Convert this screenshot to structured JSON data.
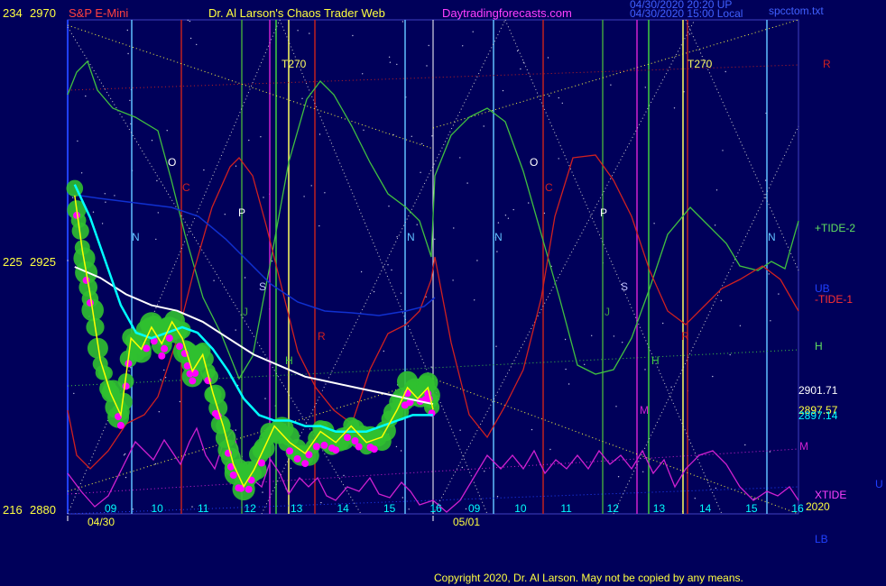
{
  "header": {
    "left_scale": "234",
    "left_price": "2970",
    "symbol": "S&P E-Mini",
    "title": "Dr. Al Larson's Chaos Trader Web",
    "site": "Daytradingforecasts.com",
    "stamp1": "04/30/2020 20:20 UP",
    "stamp2": "04/30/2020 15:00 Local",
    "file": "spcctom.txt"
  },
  "left_axis": {
    "mid_scale": "225",
    "mid_price": "2925",
    "low_scale": "216",
    "low_price": "2880"
  },
  "dates": [
    "04/30",
    "05/01"
  ],
  "hours_day1": [
    "09",
    "10",
    "11",
    "12",
    "13",
    "14",
    "15",
    "16"
  ],
  "hours_day2": [
    "09",
    "10",
    "11",
    "12",
    "13",
    "14",
    "15",
    "16"
  ],
  "year_label": "2020",
  "right_labels": {
    "r": "R",
    "tide2": "+TIDE-2",
    "ub": "UB",
    "tide1": "-TIDE-1",
    "h": "H",
    "m": "M",
    "xtide": "XTIDE",
    "lb": "LB",
    "u": "U",
    "price1": "2901.71",
    "price2": "2897.57",
    "price3": "2897.14"
  },
  "chart_labels": {
    "t270": "T270",
    "o": "O",
    "c": "C",
    "p": "P",
    "n": "N",
    "s": "S",
    "j": "J",
    "h": "H",
    "r": "R",
    "m": "M"
  },
  "copyright": "Copyright 2020, Dr. Al Larson. May not be copied by any means.",
  "colors": {
    "background": "#00005a",
    "frame": "#4040c0",
    "price": "#ffff00",
    "avg_fast": "#00ffff",
    "avg_slow": "#ffffff",
    "tide2": "#40c040",
    "tide1": "#d02020",
    "ub": "#1030d0",
    "xtide": "#d020d0",
    "cluster": "#30c030",
    "dots": "#ff00ff",
    "label_yellow": "#ffff40"
  },
  "chart_data": {
    "type": "line",
    "title": "S&P E-Mini",
    "ylim": [
      2880,
      2970
    ],
    "x_unit": "hour of session",
    "series": [
      {
        "name": "",
        "color": "yellow",
        "x": [
          9.0,
          9.15,
          9.3,
          9.5,
          9.7,
          9.9,
          10.1,
          10.3,
          10.5,
          10.7,
          10.9,
          11.1,
          11.3,
          11.5,
          11.7,
          11.9,
          12.1,
          12.3,
          12.5,
          12.7,
          12.9,
          13.2,
          13.5,
          13.8,
          14.1,
          14.4,
          14.7,
          15.0,
          15.3,
          15.5,
          15.7,
          15.9,
          16.0
        ],
        "y": [
          2938,
          2928,
          2920,
          2908,
          2902,
          2898,
          2912,
          2910,
          2914,
          2911,
          2915,
          2912,
          2906,
          2909,
          2902,
          2896,
          2889,
          2885,
          2888,
          2892,
          2896,
          2893,
          2891,
          2895,
          2893,
          2896,
          2893,
          2894,
          2899,
          2903,
          2901,
          2903,
          2899
        ]
      },
      {
        "name": "",
        "color": "cyan",
        "x": [
          9.0,
          9.3,
          9.6,
          9.9,
          10.2,
          10.5,
          10.8,
          11.1,
          11.4,
          11.7,
          12.0,
          12.3,
          12.6,
          12.9,
          13.2,
          13.5,
          13.8,
          14.1,
          14.4,
          14.7,
          15.0,
          15.3,
          15.6,
          16.0
        ],
        "y": [
          2940,
          2934,
          2926,
          2918,
          2913,
          2912,
          2913,
          2914,
          2913,
          2910,
          2906,
          2901,
          2898,
          2897,
          2897,
          2896,
          2896,
          2895,
          2895,
          2895,
          2896,
          2897,
          2898,
          2898
        ]
      },
      {
        "name": "",
        "color": "white",
        "x": [
          9.0,
          9.5,
          10.0,
          10.5,
          11.0,
          11.5,
          12.0,
          12.5,
          13.0,
          13.5,
          14.0,
          14.5,
          15.0,
          15.5,
          16.0
        ],
        "y": [
          2925,
          2923,
          2920,
          2918,
          2917,
          2915,
          2912,
          2909,
          2907,
          2905,
          2904,
          2903,
          2902,
          2901,
          2900
        ]
      }
    ]
  }
}
